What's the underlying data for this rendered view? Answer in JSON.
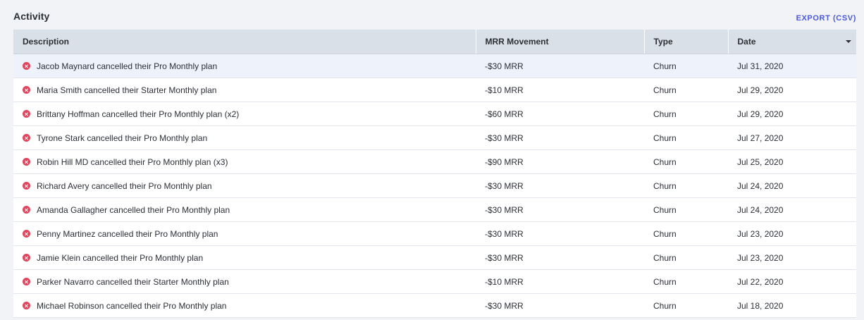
{
  "section": {
    "title": "Activity",
    "export_label": "EXPORT (CSV)"
  },
  "table": {
    "headers": {
      "description": "Description",
      "mrr": "MRR Movement",
      "type": "Type",
      "date": "Date"
    },
    "sort": {
      "column": "date",
      "icon": "caret-down-icon"
    },
    "rows": [
      {
        "icon": "churn-x-icon",
        "description": "Jacob Maynard cancelled their Pro Monthly plan",
        "mrr": "-$30 MRR",
        "type": "Churn",
        "date": "Jul 31, 2020"
      },
      {
        "icon": "churn-x-icon",
        "description": "Maria Smith cancelled their Starter Monthly plan",
        "mrr": "-$10 MRR",
        "type": "Churn",
        "date": "Jul 29, 2020"
      },
      {
        "icon": "churn-x-icon",
        "description": "Brittany Hoffman cancelled their Pro Monthly plan (x2)",
        "mrr": "-$60 MRR",
        "type": "Churn",
        "date": "Jul 29, 2020"
      },
      {
        "icon": "churn-x-icon",
        "description": "Tyrone Stark cancelled their Pro Monthly plan",
        "mrr": "-$30 MRR",
        "type": "Churn",
        "date": "Jul 27, 2020"
      },
      {
        "icon": "churn-x-icon",
        "description": "Robin Hill MD cancelled their Pro Monthly plan (x3)",
        "mrr": "-$90 MRR",
        "type": "Churn",
        "date": "Jul 25, 2020"
      },
      {
        "icon": "churn-x-icon",
        "description": "Richard Avery cancelled their Pro Monthly plan",
        "mrr": "-$30 MRR",
        "type": "Churn",
        "date": "Jul 24, 2020"
      },
      {
        "icon": "churn-x-icon",
        "description": "Amanda Gallagher cancelled their Pro Monthly plan",
        "mrr": "-$30 MRR",
        "type": "Churn",
        "date": "Jul 24, 2020"
      },
      {
        "icon": "churn-x-icon",
        "description": "Penny Martinez cancelled their Pro Monthly plan",
        "mrr": "-$30 MRR",
        "type": "Churn",
        "date": "Jul 23, 2020"
      },
      {
        "icon": "churn-x-icon",
        "description": "Jamie Klein cancelled their Pro Monthly plan",
        "mrr": "-$30 MRR",
        "type": "Churn",
        "date": "Jul 23, 2020"
      },
      {
        "icon": "churn-x-icon",
        "description": "Parker Navarro cancelled their Starter Monthly plan",
        "mrr": "-$10 MRR",
        "type": "Churn",
        "date": "Jul 22, 2020"
      },
      {
        "icon": "churn-x-icon",
        "description": "Michael Robinson cancelled their Pro Monthly plan",
        "mrr": "-$30 MRR",
        "type": "Churn",
        "date": "Jul 18, 2020"
      }
    ]
  },
  "colors": {
    "background": "#f1f3f7",
    "header": "#d9e0e8",
    "accent": "#4a59d8",
    "churn": "#e0475f",
    "highlight_row": "#eef2fb"
  }
}
